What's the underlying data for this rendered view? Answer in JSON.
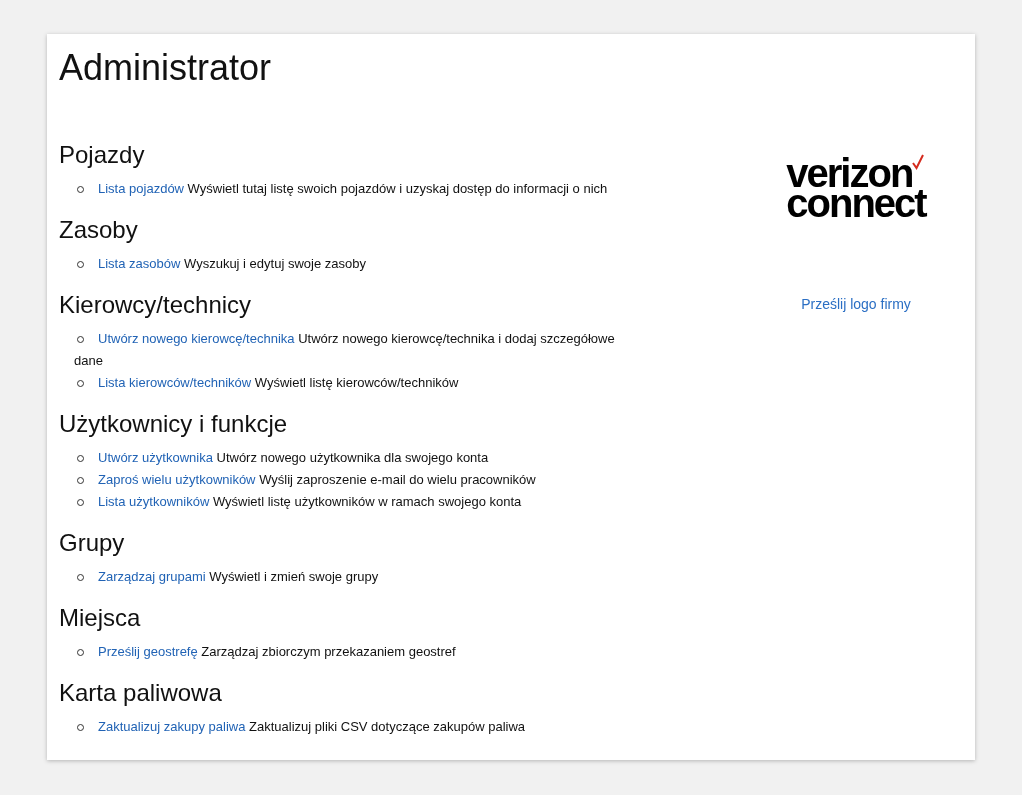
{
  "title": "Administrator",
  "sections": [
    {
      "heading": "Pojazdy",
      "items": [
        {
          "link": "Lista pojazdów",
          "description": "Wyświetl tutaj listę swoich pojazdów i uzyskaj dostęp do informacji o nich"
        }
      ]
    },
    {
      "heading": "Zasoby",
      "items": [
        {
          "link": "Lista zasobów",
          "description": "Wyszukuj i edytuj swoje zasoby"
        }
      ]
    },
    {
      "heading": "Kierowcy/technicy",
      "items": [
        {
          "link": "Utwórz nowego kierowcę/technika",
          "description": "Utwórz nowego kierowcę/technika i dodaj szczegółowe dane"
        },
        {
          "link": "Lista kierowców/techników",
          "description": "Wyświetl listę kierowców/techników"
        }
      ]
    },
    {
      "heading": "Użytkownicy i funkcje",
      "items": [
        {
          "link": "Utwórz użytkownika",
          "description": "Utwórz nowego użytkownika dla swojego konta"
        },
        {
          "link": "Zaproś wielu użytkowników",
          "description": "Wyślij zaproszenie e-mail do wielu pracowników"
        },
        {
          "link": "Lista użytkowników",
          "description": "Wyświetl listę użytkowników w ramach swojego konta"
        }
      ]
    },
    {
      "heading": "Grupy",
      "items": [
        {
          "link": "Zarządzaj grupami",
          "description": "Wyświetl i zmień swoje grupy"
        }
      ]
    },
    {
      "heading": "Miejsca",
      "items": [
        {
          "link": "Prześlij geostrefę",
          "description": "Zarządzaj zbiorczym przekazaniem geostref"
        }
      ]
    },
    {
      "heading": "Karta paliwowa",
      "items": [
        {
          "link": "Zaktualizuj zakupy paliwa",
          "description": "Zaktualizuj pliki CSV dotyczące zakupów paliwa"
        }
      ]
    }
  ],
  "logo": {
    "lines": [
      "verizon",
      "connect"
    ]
  },
  "upload_link": "Prześlij logo firmy"
}
